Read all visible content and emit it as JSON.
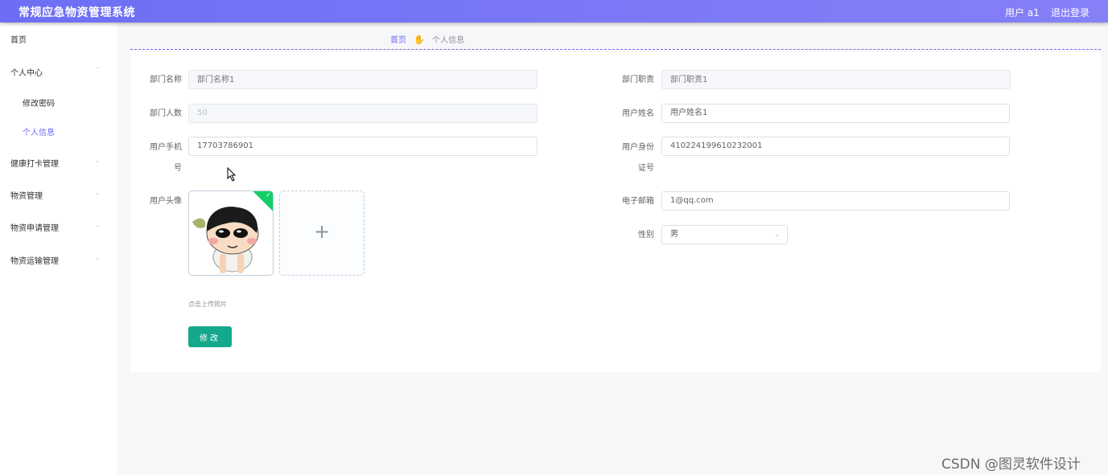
{
  "header": {
    "app_title": "常规应急物资管理系统",
    "user_label": "用户 a1",
    "logout_label": "退出登录",
    "colors": {
      "gradient_start": "#6d6ef5",
      "gradient_end": "#8580f7"
    }
  },
  "sidebar": {
    "items": [
      {
        "label": "首页"
      },
      {
        "label": "个人中心"
      },
      {
        "label": "修改密码"
      },
      {
        "label": "个人信息"
      },
      {
        "label": "健康打卡管理"
      },
      {
        "label": "物资管理"
      },
      {
        "label": "物资申请管理"
      },
      {
        "label": "物资运输管理"
      }
    ],
    "active_item": "个人信息",
    "active_color": "#6a6cf0"
  },
  "breadcrumb": {
    "home": "首页",
    "separator_icon": "hand-icon",
    "current": "个人信息"
  },
  "form": {
    "dept_name": {
      "label": "部门名称",
      "placeholder": "部门名称1"
    },
    "dept_duty": {
      "label": "部门职责",
      "placeholder": "部门职责1"
    },
    "dept_count": {
      "label": "部门人数",
      "value": "50"
    },
    "user_name": {
      "label": "用户姓名",
      "value": "用户姓名1"
    },
    "phone": {
      "label_line1": "用户手机",
      "label_line2": "号",
      "value": "17703786901"
    },
    "id_card": {
      "label_line1": "用户身份",
      "label_line2": "证号",
      "value": "410224199610232001"
    },
    "avatar": {
      "label": "用户头像",
      "upload_hint": "点击上传照片",
      "add_icon": "plus-icon"
    },
    "email": {
      "label": "电子邮箱",
      "value": "1@qq.com"
    },
    "gender": {
      "label": "性别",
      "value": "男"
    },
    "submit_label": "修改",
    "submit_color": "#14a88c"
  },
  "watermark": "CSDN @图灵软件设计"
}
